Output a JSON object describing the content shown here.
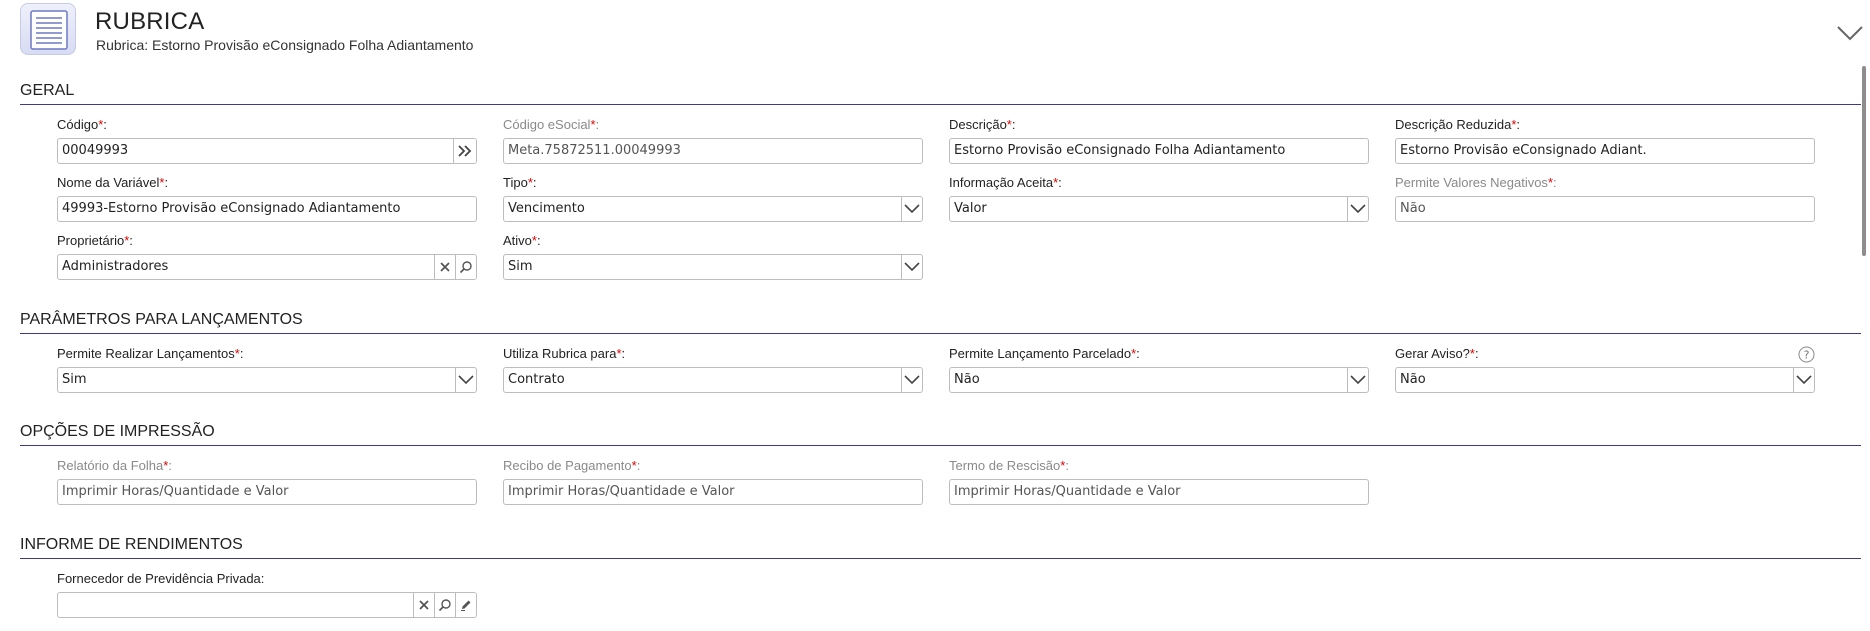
{
  "header": {
    "title": "RUBRICA",
    "subtitle": "Rubrica: Estorno Provisão eConsignado Folha Adiantamento"
  },
  "sections": {
    "geral": "GERAL",
    "parametros": "PARÂMETROS PARA LANÇAMENTOS",
    "impressao": "OPÇÕES DE IMPRESSÃO",
    "rendimentos": "INFORME DE RENDIMENTOS"
  },
  "fields": {
    "codigo": {
      "label": "Código",
      "value": "00049993"
    },
    "codigo_esocial": {
      "label": "Código eSocial",
      "value": "Meta.75872511.00049993"
    },
    "descricao": {
      "label": "Descrição",
      "value": "Estorno Provisão eConsignado Folha Adiantamento"
    },
    "descricao_reduzida": {
      "label": "Descrição Reduzida",
      "value": "Estorno Provisão eConsignado Adiant."
    },
    "nome_variavel": {
      "label": "Nome da Variável",
      "value": "49993-Estorno Provisão eConsignado Adiantamento"
    },
    "tipo": {
      "label": "Tipo",
      "value": "Vencimento"
    },
    "informacao_aceita": {
      "label": "Informação Aceita",
      "value": "Valor"
    },
    "permite_negativos": {
      "label": "Permite Valores Negativos",
      "value": "Não"
    },
    "proprietario": {
      "label": "Proprietário",
      "value": "Administradores"
    },
    "ativo": {
      "label": "Ativo",
      "value": "Sim"
    },
    "permite_lancamentos": {
      "label": "Permite Realizar Lançamentos",
      "value": "Sim"
    },
    "utiliza_rubrica": {
      "label": "Utiliza Rubrica para",
      "value": "Contrato"
    },
    "lancamento_parcelado": {
      "label": "Permite Lançamento Parcelado",
      "value": "Não"
    },
    "gerar_aviso": {
      "label": "Gerar Aviso?",
      "value": "Não"
    },
    "relatorio_folha": {
      "label": "Relatório da Folha",
      "value": "Imprimir Horas/Quantidade e Valor"
    },
    "recibo_pagamento": {
      "label": "Recibo de Pagamento",
      "value": "Imprimir Horas/Quantidade e Valor"
    },
    "termo_rescisao": {
      "label": "Termo de Rescisão",
      "value": "Imprimir Horas/Quantidade e Valor"
    },
    "fornecedor_previdencia": {
      "label": "Fornecedor de Previdência Privada:",
      "value": ""
    }
  },
  "required_mark": "*",
  "label_suffix": ":",
  "colors": {
    "accent_line": "#3f3b8a",
    "required": "#dd0000"
  }
}
